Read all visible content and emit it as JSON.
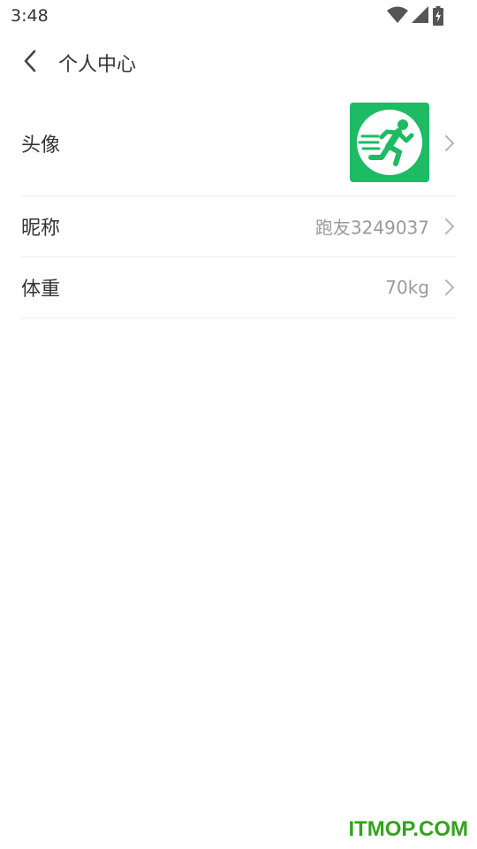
{
  "status_bar": {
    "time": "3:48",
    "icons": [
      "wifi-icon",
      "signal-icon",
      "battery-charging-icon"
    ]
  },
  "header": {
    "title": "个人中心",
    "back_icon": "chevron-left-icon"
  },
  "profile": {
    "avatar": {
      "label": "头像",
      "icon": "running-man-icon",
      "color": "#1dbb63"
    },
    "nickname": {
      "label": "昵称",
      "value": "跑友3249037"
    },
    "weight": {
      "label": "体重",
      "value": "70kg"
    }
  },
  "watermark": {
    "text": "ITMOP.COM",
    "color": "#33a31e"
  }
}
